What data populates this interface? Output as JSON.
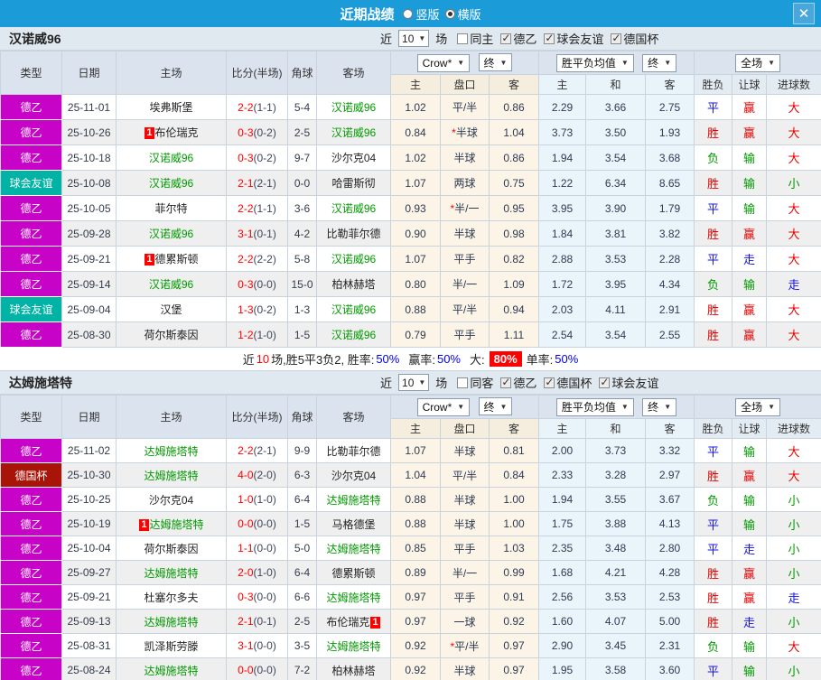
{
  "titlebar": {
    "title": "近期战绩",
    "radio_vertical": "竖版",
    "radio_horizontal": "横版",
    "close": "✕"
  },
  "columns": {
    "left": [
      "类型",
      "日期",
      "主场",
      "比分(半场)",
      "角球",
      "客场"
    ],
    "dropdowns": [
      "Crow*",
      "终",
      "胜平负均值",
      "终",
      "全场"
    ],
    "sub": [
      "主",
      "盘口",
      "客",
      "主",
      "和",
      "客",
      "胜负",
      "让球",
      "进球数"
    ]
  },
  "colors": {
    "titlebar": "#1b9bd8",
    "league_de2": "#c803c8",
    "league_friendly": "#00b3a4",
    "league_cup": "#a81408",
    "team_highlight": "#009900",
    "score": "#ff0000",
    "win": "#e60000",
    "draw": "#1414e6",
    "loss": "#009900"
  },
  "tables": [
    {
      "team": "汉诺威96",
      "filter": {
        "prefix": "近",
        "count": "10",
        "suffix": "场",
        "same_label": "同主",
        "same_checked": false,
        "leagues": [
          {
            "label": "德乙",
            "checked": true
          },
          {
            "label": "球会友谊",
            "checked": true
          },
          {
            "label": "德国杯",
            "checked": true
          }
        ]
      },
      "rows": [
        {
          "type": "德乙",
          "date": "25-11-01",
          "home": "埃弗斯堡",
          "home_hl": false,
          "home_badge": "",
          "score": "2-2",
          "half": "(1-1)",
          "corner": "5-4",
          "away": "汉诺威96",
          "away_hl": true,
          "away_badge": "",
          "crow_home": "1.02",
          "handicap": "平/半",
          "crow_away": "0.86",
          "avg_home": "2.29",
          "avg_draw": "3.66",
          "avg_away": "2.75",
          "wdl": "平",
          "hcp_res": "赢",
          "goal_res": "大"
        },
        {
          "type": "德乙",
          "date": "25-10-26",
          "home": "布伦瑞克",
          "home_hl": false,
          "home_badge": "1",
          "score": "0-3",
          "half": "(0-2)",
          "corner": "2-5",
          "away": "汉诺威96",
          "away_hl": true,
          "away_badge": "",
          "crow_home": "0.84",
          "handicap": "*半球",
          "crow_away": "1.04",
          "avg_home": "3.73",
          "avg_draw": "3.50",
          "avg_away": "1.93",
          "wdl": "胜",
          "hcp_res": "赢",
          "goal_res": "大"
        },
        {
          "type": "德乙",
          "date": "25-10-18",
          "home": "汉诺威96",
          "home_hl": true,
          "home_badge": "",
          "score": "0-3",
          "half": "(0-2)",
          "corner": "9-7",
          "away": "沙尔克04",
          "away_hl": false,
          "away_badge": "",
          "crow_home": "1.02",
          "handicap": "半球",
          "crow_away": "0.86",
          "avg_home": "1.94",
          "avg_draw": "3.54",
          "avg_away": "3.68",
          "wdl": "负",
          "hcp_res": "输",
          "goal_res": "大"
        },
        {
          "type": "球会友谊",
          "date": "25-10-08",
          "home": "汉诺威96",
          "home_hl": true,
          "home_badge": "",
          "score": "2-1",
          "half": "(2-1)",
          "corner": "0-0",
          "away": "哈雷斯彻",
          "away_hl": false,
          "away_badge": "",
          "crow_home": "1.07",
          "handicap": "两球",
          "crow_away": "0.75",
          "avg_home": "1.22",
          "avg_draw": "6.34",
          "avg_away": "8.65",
          "wdl": "胜",
          "hcp_res": "输",
          "goal_res": "小"
        },
        {
          "type": "德乙",
          "date": "25-10-05",
          "home": "菲尔特",
          "home_hl": false,
          "home_badge": "",
          "score": "2-2",
          "half": "(1-1)",
          "corner": "3-6",
          "away": "汉诺威96",
          "away_hl": true,
          "away_badge": "",
          "crow_home": "0.93",
          "handicap": "*半/一",
          "crow_away": "0.95",
          "avg_home": "3.95",
          "avg_draw": "3.90",
          "avg_away": "1.79",
          "wdl": "平",
          "hcp_res": "输",
          "goal_res": "大"
        },
        {
          "type": "德乙",
          "date": "25-09-28",
          "home": "汉诺威96",
          "home_hl": true,
          "home_badge": "",
          "score": "3-1",
          "half": "(0-1)",
          "corner": "4-2",
          "away": "比勒菲尔德",
          "away_hl": false,
          "away_badge": "",
          "crow_home": "0.90",
          "handicap": "半球",
          "crow_away": "0.98",
          "avg_home": "1.84",
          "avg_draw": "3.81",
          "avg_away": "3.82",
          "wdl": "胜",
          "hcp_res": "赢",
          "goal_res": "大"
        },
        {
          "type": "德乙",
          "date": "25-09-21",
          "home": "德累斯顿",
          "home_hl": false,
          "home_badge": "1",
          "score": "2-2",
          "half": "(2-2)",
          "corner": "5-8",
          "away": "汉诺威96",
          "away_hl": true,
          "away_badge": "",
          "crow_home": "1.07",
          "handicap": "平手",
          "crow_away": "0.82",
          "avg_home": "2.88",
          "avg_draw": "3.53",
          "avg_away": "2.28",
          "wdl": "平",
          "hcp_res": "走",
          "goal_res": "大"
        },
        {
          "type": "德乙",
          "date": "25-09-14",
          "home": "汉诺威96",
          "home_hl": true,
          "home_badge": "",
          "score": "0-3",
          "half": "(0-0)",
          "corner": "15-0",
          "away": "柏林赫塔",
          "away_hl": false,
          "away_badge": "",
          "crow_home": "0.80",
          "handicap": "半/一",
          "crow_away": "1.09",
          "avg_home": "1.72",
          "avg_draw": "3.95",
          "avg_away": "4.34",
          "wdl": "负",
          "hcp_res": "输",
          "goal_res": "走"
        },
        {
          "type": "球会友谊",
          "date": "25-09-04",
          "home": "汉堡",
          "home_hl": false,
          "home_badge": "",
          "score": "1-3",
          "half": "(0-2)",
          "corner": "1-3",
          "away": "汉诺威96",
          "away_hl": true,
          "away_badge": "",
          "crow_home": "0.88",
          "handicap": "平/半",
          "crow_away": "0.94",
          "avg_home": "2.03",
          "avg_draw": "4.11",
          "avg_away": "2.91",
          "wdl": "胜",
          "hcp_res": "赢",
          "goal_res": "大"
        },
        {
          "type": "德乙",
          "date": "25-08-30",
          "home": "荷尔斯泰因",
          "home_hl": false,
          "home_badge": "",
          "score": "1-2",
          "half": "(1-0)",
          "corner": "1-5",
          "away": "汉诺威96",
          "away_hl": true,
          "away_badge": "",
          "crow_home": "0.79",
          "handicap": "平手",
          "crow_away": "1.11",
          "avg_home": "2.54",
          "avg_draw": "3.54",
          "avg_away": "2.55",
          "wdl": "胜",
          "hcp_res": "赢",
          "goal_res": "大"
        }
      ],
      "summary": {
        "pre": "近",
        "count": "10",
        "mid": "场,胜5平3负2, 胜率:",
        "win_rate": "50%",
        "l2": "赢率:",
        "hcp_rate": "50%",
        "l3": "大:",
        "big_rate": "80%",
        "l4": "单率:",
        "single_rate": "50%"
      }
    },
    {
      "team": "达姆施塔特",
      "filter": {
        "prefix": "近",
        "count": "10",
        "suffix": "场",
        "same_label": "同客",
        "same_checked": false,
        "leagues": [
          {
            "label": "德乙",
            "checked": true
          },
          {
            "label": "德国杯",
            "checked": true
          },
          {
            "label": "球会友谊",
            "checked": true
          }
        ]
      },
      "rows": [
        {
          "type": "德乙",
          "date": "25-11-02",
          "home": "达姆施塔特",
          "home_hl": true,
          "home_badge": "",
          "score": "2-2",
          "half": "(2-1)",
          "corner": "9-9",
          "away": "比勒菲尔德",
          "away_hl": false,
          "away_badge": "",
          "crow_home": "1.07",
          "handicap": "半球",
          "crow_away": "0.81",
          "avg_home": "2.00",
          "avg_draw": "3.73",
          "avg_away": "3.32",
          "wdl": "平",
          "hcp_res": "输",
          "goal_res": "大"
        },
        {
          "type": "德国杯",
          "date": "25-10-30",
          "home": "达姆施塔特",
          "home_hl": true,
          "home_badge": "",
          "score": "4-0",
          "half": "(2-0)",
          "corner": "6-3",
          "away": "沙尔克04",
          "away_hl": false,
          "away_badge": "",
          "crow_home": "1.04",
          "handicap": "平/半",
          "crow_away": "0.84",
          "avg_home": "2.33",
          "avg_draw": "3.28",
          "avg_away": "2.97",
          "wdl": "胜",
          "hcp_res": "赢",
          "goal_res": "大"
        },
        {
          "type": "德乙",
          "date": "25-10-25",
          "home": "沙尔克04",
          "home_hl": false,
          "home_badge": "",
          "score": "1-0",
          "half": "(1-0)",
          "corner": "6-4",
          "away": "达姆施塔特",
          "away_hl": true,
          "away_badge": "",
          "crow_home": "0.88",
          "handicap": "半球",
          "crow_away": "1.00",
          "avg_home": "1.94",
          "avg_draw": "3.55",
          "avg_away": "3.67",
          "wdl": "负",
          "hcp_res": "输",
          "goal_res": "小"
        },
        {
          "type": "德乙",
          "date": "25-10-19",
          "home": "达姆施塔特",
          "home_hl": true,
          "home_badge": "1",
          "score": "0-0",
          "half": "(0-0)",
          "corner": "1-5",
          "away": "马格德堡",
          "away_hl": false,
          "away_badge": "",
          "crow_home": "0.88",
          "handicap": "半球",
          "crow_away": "1.00",
          "avg_home": "1.75",
          "avg_draw": "3.88",
          "avg_away": "4.13",
          "wdl": "平",
          "hcp_res": "输",
          "goal_res": "小"
        },
        {
          "type": "德乙",
          "date": "25-10-04",
          "home": "荷尔斯泰因",
          "home_hl": false,
          "home_badge": "",
          "score": "1-1",
          "half": "(0-0)",
          "corner": "5-0",
          "away": "达姆施塔特",
          "away_hl": true,
          "away_badge": "",
          "crow_home": "0.85",
          "handicap": "平手",
          "crow_away": "1.03",
          "avg_home": "2.35",
          "avg_draw": "3.48",
          "avg_away": "2.80",
          "wdl": "平",
          "hcp_res": "走",
          "goal_res": "小"
        },
        {
          "type": "德乙",
          "date": "25-09-27",
          "home": "达姆施塔特",
          "home_hl": true,
          "home_badge": "",
          "score": "2-0",
          "half": "(1-0)",
          "corner": "6-4",
          "away": "德累斯顿",
          "away_hl": false,
          "away_badge": "",
          "crow_home": "0.89",
          "handicap": "半/一",
          "crow_away": "0.99",
          "avg_home": "1.68",
          "avg_draw": "4.21",
          "avg_away": "4.28",
          "wdl": "胜",
          "hcp_res": "赢",
          "goal_res": "小"
        },
        {
          "type": "德乙",
          "date": "25-09-21",
          "home": "杜塞尔多夫",
          "home_hl": false,
          "home_badge": "",
          "score": "0-3",
          "half": "(0-0)",
          "corner": "6-6",
          "away": "达姆施塔特",
          "away_hl": true,
          "away_badge": "",
          "crow_home": "0.97",
          "handicap": "平手",
          "crow_away": "0.91",
          "avg_home": "2.56",
          "avg_draw": "3.53",
          "avg_away": "2.53",
          "wdl": "胜",
          "hcp_res": "赢",
          "goal_res": "走"
        },
        {
          "type": "德乙",
          "date": "25-09-13",
          "home": "达姆施塔特",
          "home_hl": true,
          "home_badge": "",
          "score": "2-1",
          "half": "(0-1)",
          "corner": "2-5",
          "away": "布伦瑞克",
          "away_hl": false,
          "away_badge": "1",
          "crow_home": "0.97",
          "handicap": "一球",
          "crow_away": "0.92",
          "avg_home": "1.60",
          "avg_draw": "4.07",
          "avg_away": "5.00",
          "wdl": "胜",
          "hcp_res": "走",
          "goal_res": "小"
        },
        {
          "type": "德乙",
          "date": "25-08-31",
          "home": "凯泽斯劳滕",
          "home_hl": false,
          "home_badge": "",
          "score": "3-1",
          "half": "(0-0)",
          "corner": "3-5",
          "away": "达姆施塔特",
          "away_hl": true,
          "away_badge": "",
          "crow_home": "0.92",
          "handicap": "*平/半",
          "crow_away": "0.97",
          "avg_home": "2.90",
          "avg_draw": "3.45",
          "avg_away": "2.31",
          "wdl": "负",
          "hcp_res": "输",
          "goal_res": "大"
        },
        {
          "type": "德乙",
          "date": "25-08-24",
          "home": "达姆施塔特",
          "home_hl": true,
          "home_badge": "",
          "score": "0-0",
          "half": "(0-0)",
          "corner": "7-2",
          "away": "柏林赫塔",
          "away_hl": false,
          "away_badge": "",
          "crow_home": "0.92",
          "handicap": "半球",
          "crow_away": "0.97",
          "avg_home": "1.95",
          "avg_draw": "3.58",
          "avg_away": "3.60",
          "wdl": "平",
          "hcp_res": "输",
          "goal_res": "小"
        }
      ]
    }
  ]
}
